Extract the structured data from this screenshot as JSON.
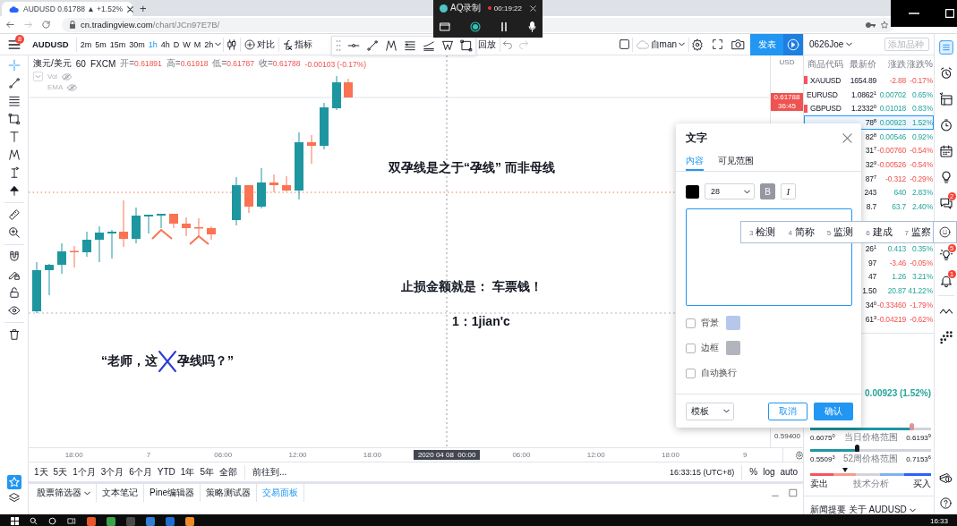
{
  "browser": {
    "tab_title": "AUDUSD 0.61788 ▲ +1.52%",
    "new_tab": "+",
    "url_host": "cn.tradingview.com",
    "url_path": "/chart/JCn97E7B/"
  },
  "recorder": {
    "title": "AQ录制",
    "elapsed": "00:19:22"
  },
  "toolbar": {
    "menu_badge": "8",
    "symbol": "AUDUSD",
    "intervals": [
      {
        "label": "2m",
        "selected": false
      },
      {
        "label": "5m",
        "selected": false
      },
      {
        "label": "15m",
        "selected": false
      },
      {
        "label": "30m",
        "selected": false
      },
      {
        "label": "1h",
        "selected": true
      },
      {
        "label": "4h",
        "selected": false
      },
      {
        "label": "D",
        "selected": false
      },
      {
        "label": "W",
        "selected": false
      },
      {
        "label": "M",
        "selected": false
      },
      {
        "label": "2h",
        "selected": false
      }
    ],
    "compare": "对比",
    "indicators": "指标",
    "replay": "回放",
    "layout": "自man",
    "publish": "发表"
  },
  "left_toolbar": {
    "favorites_selected": true
  },
  "legend": {
    "symbol": "澳元/美元",
    "interval": "60",
    "exchange": "FXCM",
    "ohlc": [
      {
        "label": "开=",
        "value": "0.61891"
      },
      {
        "label": "高=",
        "value": "0.61918"
      },
      {
        "label": "低=",
        "value": "0.61787"
      },
      {
        "label": "收=",
        "value": "0.61788"
      }
    ],
    "change": "-0.00103 (-0.17%)",
    "studies": [
      "Vol",
      "EMA"
    ]
  },
  "annotations": [
    {
      "kind": "text",
      "text": "双孕线是之于“孕线” 而非母线"
    },
    {
      "kind": "text",
      "text": "止损金额就是： 车票钱！"
    },
    {
      "kind": "text",
      "text": "1：1jian'c"
    },
    {
      "kind": "struck",
      "before": "“老师，这",
      "after": "孕线吗？”"
    }
  ],
  "price_axis": {
    "currency": "USD",
    "last_price": "0.61788",
    "countdown": "36:45",
    "bottom_tick": "0.59400"
  },
  "time_axis": [
    {
      "label": "18:00",
      "kind": "tick"
    },
    {
      "label": "7",
      "kind": "tick"
    },
    {
      "label": "06:00",
      "kind": "tick"
    },
    {
      "label": "12:00",
      "kind": "tick"
    },
    {
      "label": "18:00",
      "kind": "tick"
    },
    {
      "label": "2020 04 08  00:00",
      "kind": "crosshair"
    },
    {
      "label": "06:00",
      "kind": "tick"
    },
    {
      "label": "12:00",
      "kind": "tick"
    },
    {
      "label": "18:00",
      "kind": "tick"
    },
    {
      "label": "9",
      "kind": "tick"
    }
  ],
  "range_bar": {
    "ranges": [
      "1天",
      "5天",
      "1个月",
      "3个月",
      "6个月",
      "YTD",
      "1年",
      "5年",
      "全部"
    ],
    "goto": "前往到...",
    "clock": "16:33:15 (UTC+8)",
    "scales": [
      "%",
      "log",
      "auto"
    ]
  },
  "bottom_tabs": [
    {
      "label": "股票筛选器",
      "dropdown": true,
      "selected": false
    },
    {
      "label": "文本笔记",
      "dropdown": false,
      "selected": false
    },
    {
      "label": "Pine编辑器",
      "dropdown": false,
      "selected": false
    },
    {
      "label": "策略测试器",
      "dropdown": false,
      "selected": false
    },
    {
      "label": "交易面板",
      "dropdown": false,
      "selected": true
    }
  ],
  "watchlist": {
    "name": "0626Joe",
    "search_placeholder": "添加品种",
    "columns": [
      "商品代码",
      "最新价",
      "涨跌",
      "涨跌%"
    ],
    "rows": [
      {
        "symbol": "XAUUSD",
        "flagged": true,
        "price": "1654.89",
        "change": "-2.88",
        "change_pct": "-0.17%",
        "rising": false,
        "selected": false
      },
      {
        "symbol": "EURUSD",
        "flagged": false,
        "price": "1.0862$^{1}$",
        "change": "0.00702",
        "change_pct": "0.65%",
        "rising": true,
        "selected": false
      },
      {
        "symbol": "GBPUSD",
        "flagged": true,
        "price": "1.2332$^{0}$",
        "change": "0.01018",
        "change_pct": "0.83%",
        "rising": true,
        "selected": false
      },
      {
        "price": "78$^{8}$",
        "change": "0.00923",
        "change_pct": "1.52%",
        "rising": true,
        "selected": true
      },
      {
        "price": "82$^{8}$",
        "change": "0.00546",
        "change_pct": "0.92%",
        "rising": true,
        "selected": false
      },
      {
        "price": "31$^{7}$",
        "change": "-0.00760",
        "change_pct": "-0.54%",
        "rising": false,
        "selected": false
      },
      {
        "price": "32$^{9}$",
        "change": "-0.00526",
        "change_pct": "-0.54%",
        "rising": false,
        "selected": false
      },
      {
        "price": "87$^{7}$",
        "change": "-0.312",
        "change_pct": "-0.29%",
        "rising": false,
        "selected": false
      },
      {
        "price": "243",
        "change": "640",
        "change_pct": "2.83%",
        "rising": true,
        "selected": false
      },
      {
        "price": "8.7",
        "change": "63.7",
        "change_pct": "2.40%",
        "rising": true,
        "selected": false
      }
    ],
    "more_rows": [
      {
        "price": "26$^{1}$",
        "change": "0.413",
        "change_pct": "0.35%",
        "rising": true,
        "selected": false
      },
      {
        "price": "97",
        "change": "-3.46",
        "change_pct": "-0.05%",
        "rising": false,
        "selected": false
      },
      {
        "price": "47",
        "change": "1.26",
        "change_pct": "3.21%",
        "rising": true,
        "selected": false
      },
      {
        "price": "1.50",
        "change": "20.87",
        "change_pct": "41.22%",
        "rising": true,
        "selected": false
      },
      {
        "price": "34$^{0}$",
        "change": "-0.33460",
        "change_pct": "-1.79%",
        "rising": false,
        "selected": false
      },
      {
        "price": "61$^{3}$",
        "change": "-0.04219",
        "change_pct": "-0.62%",
        "rising": false,
        "selected": false
      }
    ]
  },
  "details": {
    "change_summary": "0.00923 (1.52%)",
    "day_range": {
      "low": "0.6075$^{0}$",
      "label": "当日价格范围",
      "high": "0.6193$^{9}$",
      "level": 0.84
    },
    "year_range": {
      "low": "0.5509$^{3}$",
      "label": "52周价格范围",
      "high": "0.7153$^{6}$",
      "level": 0.39
    },
    "rating": {
      "level": 0.29,
      "sell": "卖出",
      "label": "技术分析",
      "buy": "买入"
    },
    "news": "新闻提要 关于 AUDUSD"
  },
  "right_strip": {
    "items": [
      {
        "kind": "watchlist",
        "selected": true
      },
      {
        "kind": "alarm",
        "selected": false
      },
      {
        "kind": "data",
        "selected": false
      },
      {
        "kind": "clock",
        "selected": false
      },
      {
        "kind": "calendar",
        "selected": false
      },
      {
        "kind": "bulb",
        "selected": false
      },
      {
        "kind": "chat",
        "selected": false,
        "badge": "2"
      },
      {
        "kind": "ideas",
        "selected": false,
        "badge": "5"
      },
      {
        "kind": "bell",
        "selected": false,
        "badge": "1"
      },
      {
        "kind": "wave",
        "selected": false
      },
      {
        "kind": "dots",
        "selected": false
      }
    ],
    "bottom": [
      {
        "kind": "money",
        "selected": false
      },
      {
        "kind": "help",
        "selected": false
      }
    ]
  },
  "text_dialog": {
    "title": "文字",
    "tabs": [
      {
        "label": "内容",
        "selected": true
      },
      {
        "label": "可见范围",
        "selected": false
      }
    ],
    "font_size": "28",
    "format_buttons": [
      {
        "label": "B",
        "kind": "bold",
        "on": true
      },
      {
        "label": "I",
        "kind": "italic",
        "on": false
      }
    ],
    "options": [
      {
        "label": "背景",
        "checked": false,
        "color": "#b5c7ea"
      },
      {
        "label": "边框",
        "checked": false,
        "color": "#b2b5be"
      },
      {
        "label": "自动换行",
        "checked": false
      }
    ],
    "template": "模板",
    "cancel": "取消",
    "confirm": "确认"
  },
  "ime": {
    "candidates": [
      {
        "index": "3",
        "word": "检测"
      },
      {
        "index": "4",
        "word": "简称"
      },
      {
        "index": "5",
        "word": "监测"
      },
      {
        "index": "6",
        "word": "建成"
      },
      {
        "index": "7",
        "word": "监察"
      }
    ]
  },
  "taskbar": {
    "clock": "16:33"
  }
}
